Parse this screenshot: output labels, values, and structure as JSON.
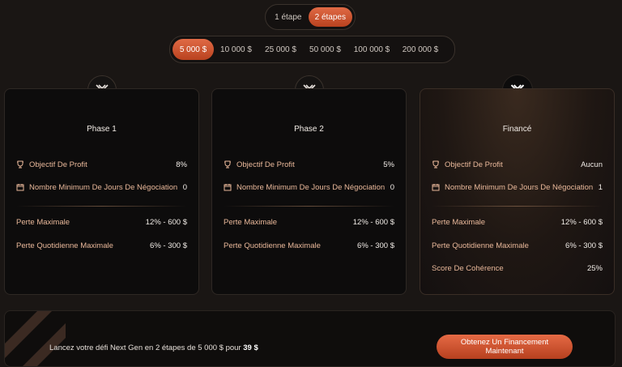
{
  "steps": {
    "options": [
      "1 étape",
      "2 étapes"
    ],
    "selected_index": 1
  },
  "amounts": {
    "options": [
      "5 000 $",
      "10 000 $",
      "25 000 $",
      "50 000 $",
      "100 000 $",
      "200 000 $"
    ],
    "selected_index": 0
  },
  "cards": [
    {
      "title": "Phase 1",
      "profit_label": "Objectif De Profit",
      "profit_value": "8%",
      "days_label": "Nombre Minimum De Jours De Négociation",
      "days_value": "0",
      "max_loss_label": "Perte Maximale",
      "max_loss_value": "12% - 600 $",
      "daily_loss_label": "Perte Quotidienne Maximale",
      "daily_loss_value": "6% - 300 $"
    },
    {
      "title": "Phase 2",
      "profit_label": "Objectif De Profit",
      "profit_value": "5%",
      "days_label": "Nombre Minimum De Jours De Négociation",
      "days_value": "0",
      "max_loss_label": "Perte Maximale",
      "max_loss_value": "12% - 600 $",
      "daily_loss_label": "Perte Quotidienne Maximale",
      "daily_loss_value": "6% - 300 $"
    },
    {
      "title": "Financé",
      "profit_label": "Objectif De Profit",
      "profit_value": "Aucun",
      "days_label": "Nombre Minimum De Jours De Négociation",
      "days_value": "1",
      "max_loss_label": "Perte Maximale",
      "max_loss_value": "12% - 600 $",
      "daily_loss_label": "Perte Quotidienne Maximale",
      "daily_loss_value": "6% - 300 $",
      "consistency_label": "Score De Cohérence",
      "consistency_value": "25%"
    }
  ],
  "cta_bar": {
    "text_prefix": "Lancez votre défi Next Gen en 2 étapes de 5 000 $ pour",
    "price": "39 $",
    "button_label": "Obtenez Un Financement Maintenant"
  },
  "colors": {
    "accent": "#d4552f",
    "label": "#e9b89a",
    "background": "#1a1614"
  },
  "icons": {
    "badge": "brand-logo-icon",
    "profit": "trophy-icon",
    "days": "calendar-icon"
  }
}
